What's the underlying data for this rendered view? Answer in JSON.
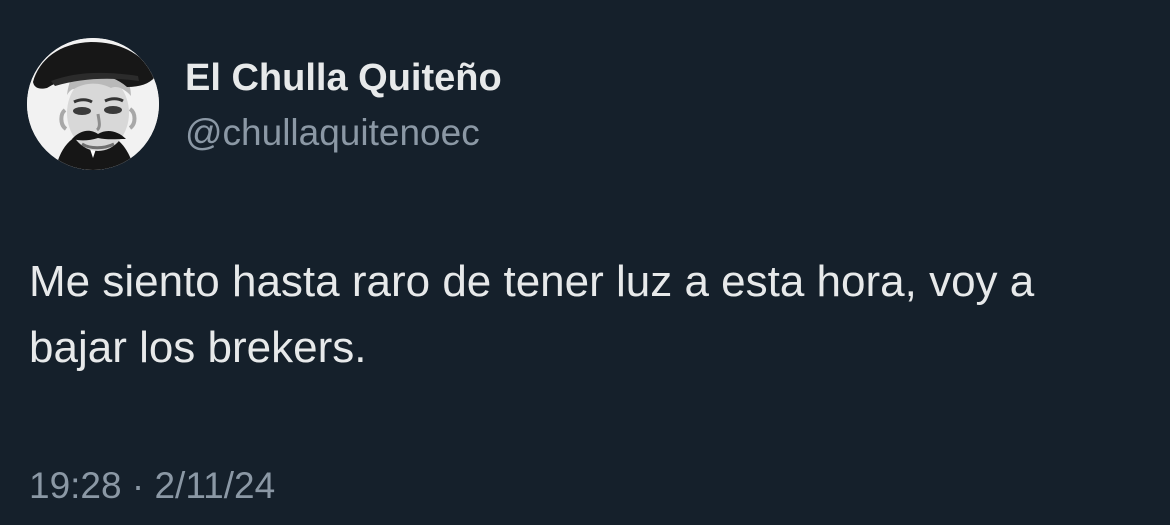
{
  "author": {
    "display_name": "El Chulla Quiteño",
    "handle": "@chullaquitenoec",
    "avatar_icon": "avatar-photo"
  },
  "tweet": {
    "text": "Me siento hasta raro de tener luz a esta hora, voy a bajar los brekers.",
    "timestamp": "19:28 · 2/11/24"
  },
  "colors": {
    "background": "#15202b",
    "primary_text": "#e7e9ea",
    "secondary_text": "#8b98a5"
  }
}
